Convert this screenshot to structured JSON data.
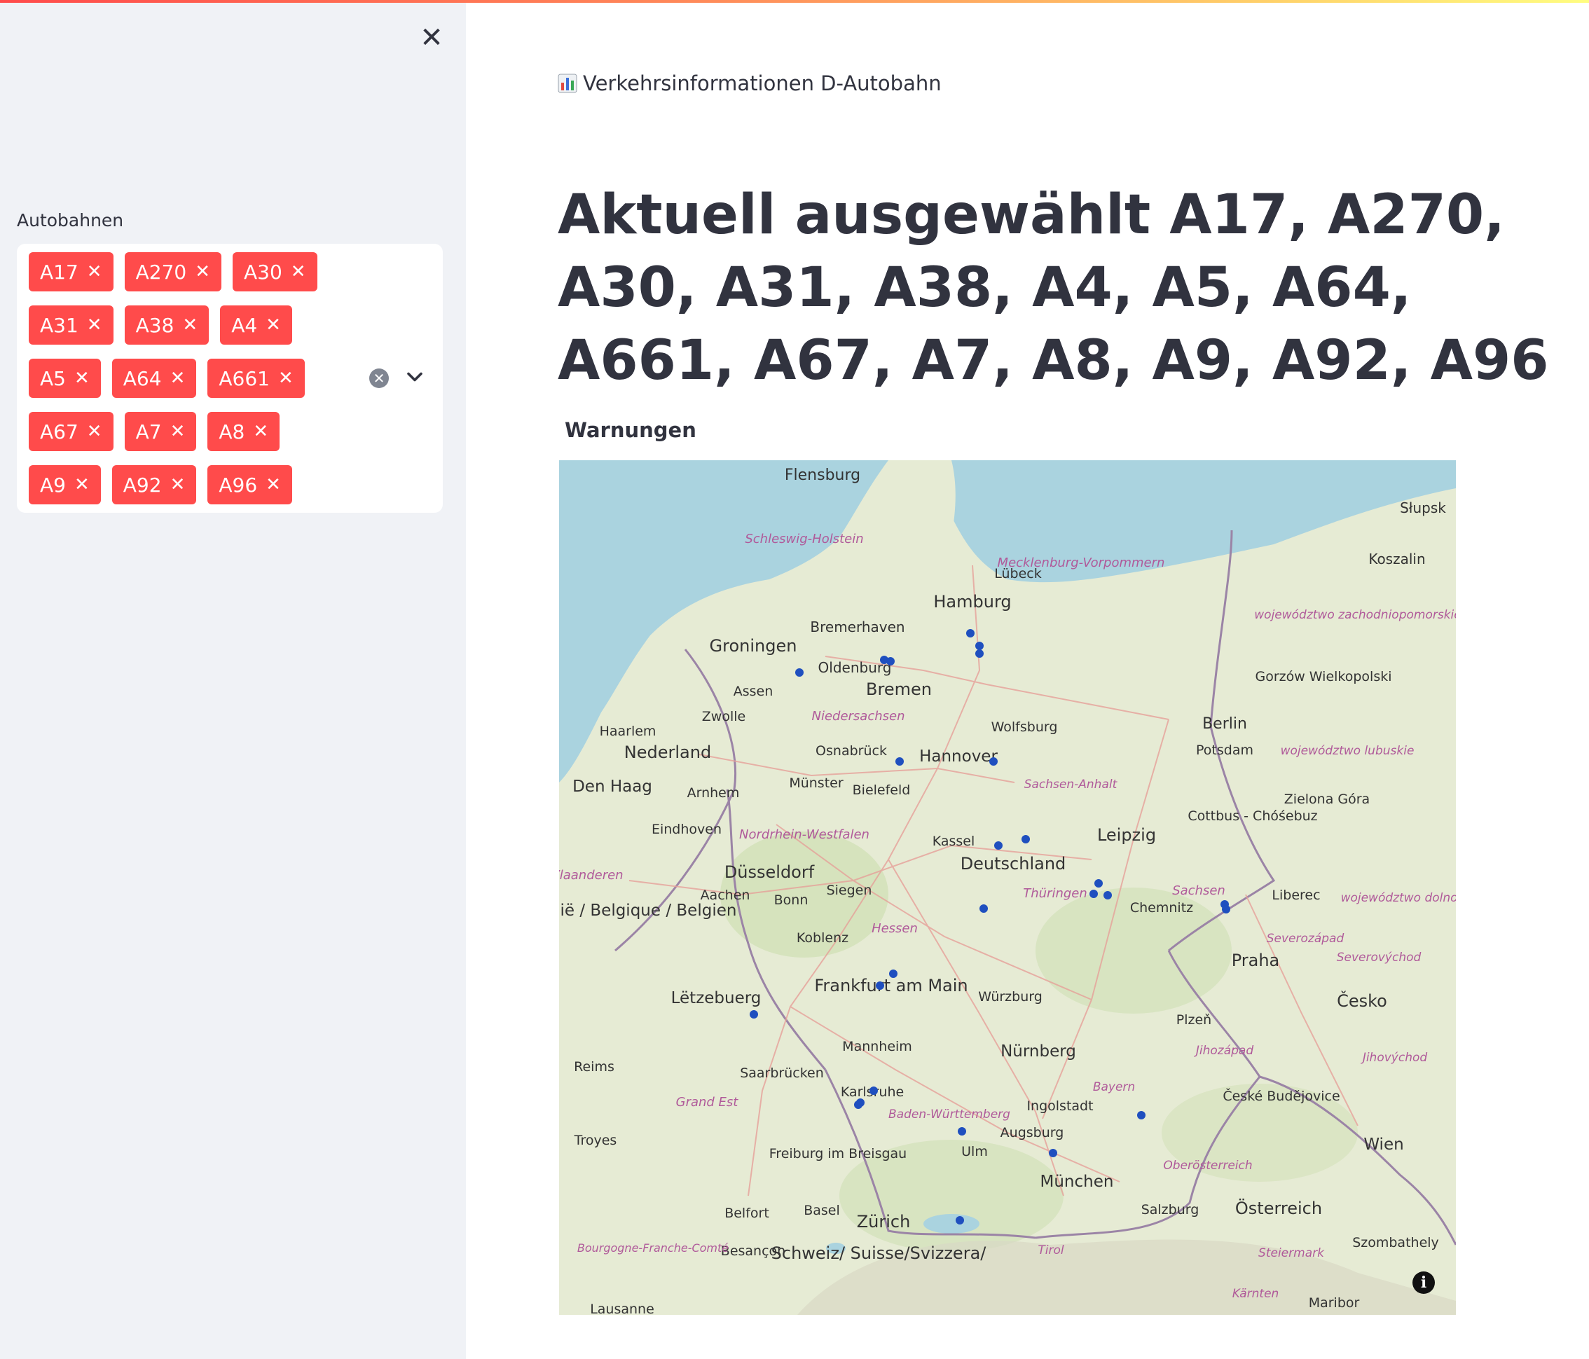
{
  "sidebar": {
    "close_glyph": "✕",
    "select_label": "Autobahnen",
    "chips": [
      [
        "A17",
        "A270",
        "A30"
      ],
      [
        "A31",
        "A38",
        "A4"
      ],
      [
        "A5",
        "A64",
        "A661"
      ],
      [
        "A67",
        "A7",
        "A8"
      ],
      [
        "A9",
        "A92",
        "A96"
      ]
    ],
    "chip_remove_glyph": "✕",
    "clear_glyph": "✕"
  },
  "main": {
    "app_title": "Verkehrsinformationen D-Autobahn",
    "headline": "Aktuell ausgewählt A17, A270, A30, A31, A38, A4, A5, A64, A661, A67, A7, A8, A9, A92, A96",
    "map_label": "Warnungen",
    "info_glyph": "i"
  },
  "map": {
    "cities": [
      "Flensburg",
      "Schleswig-Holstein",
      "Lübeck",
      "Mecklenburg-Vorpommern",
      "Hamburg",
      "Słupsk",
      "Koszalin",
      "Bremerhaven",
      "Groningen",
      "Oldenburg",
      "Bremen",
      "Assen",
      "Zwolle",
      "Niedersachsen",
      "Haarlem",
      "Nederland",
      "Osnabrück",
      "Wolfsburg",
      "Hannover",
      "Berlin",
      "Potsdam",
      "Den Haag",
      "Münster",
      "Arnhem",
      "Bielefeld",
      "Sachsen-Anhalt",
      "Eindhoven",
      "Nordrhein-Westfalen",
      "Kassel",
      "Leipzig",
      "Deutschland",
      "Düsseldorf",
      "Aachen",
      "Bonn",
      "Siegen",
      "Thüringen",
      "Sachsen",
      "Chemnitz",
      "Liberec",
      "België / Belgique / Belgien",
      "Koblenz",
      "Hessen",
      "Praha",
      "Frankfurt am Main",
      "Würzburg",
      "Lëtzebuerg",
      "Česko",
      "Plzeň",
      "Mannheim",
      "Nürnberg",
      "Reims",
      "Saarbrücken",
      "Karlsruhe",
      "Bayern",
      "Grand Est",
      "Ingolstadt",
      "Baden-Württemberg",
      "Augsburg",
      "Troyes",
      "Freiburg im Breisgau",
      "Ulm",
      "München",
      "Wien",
      "Belfort",
      "Basel",
      "Zürich",
      "Salzburg",
      "Österreich",
      "Schweiz/ Suisse/Svizzera/",
      "Besançon",
      "Tirol",
      "Steiermark",
      "Kärnten",
      "Maribor",
      "Szombathely",
      "Gorzów Wielkopolski",
      "Cottbus - Chóśebuz",
      "Zielona Góra",
      "České Budějovice",
      "Lausanne",
      "Bourgogne-Franche-Comté",
      "Oberösterreich",
      "Jihozápad",
      "Jihovýchod",
      "Severozápad",
      "Severovýchod",
      "województwo zachodniopomorskie",
      "województwo lubuskie",
      "województwo dolnośląskie",
      "Vlaanderen"
    ],
    "warnings_count": 26,
    "colors": {
      "sea": "#aad3df",
      "land": "#e6ebd4",
      "marker": "#1f4fbf",
      "border": "#9b84a6"
    }
  }
}
